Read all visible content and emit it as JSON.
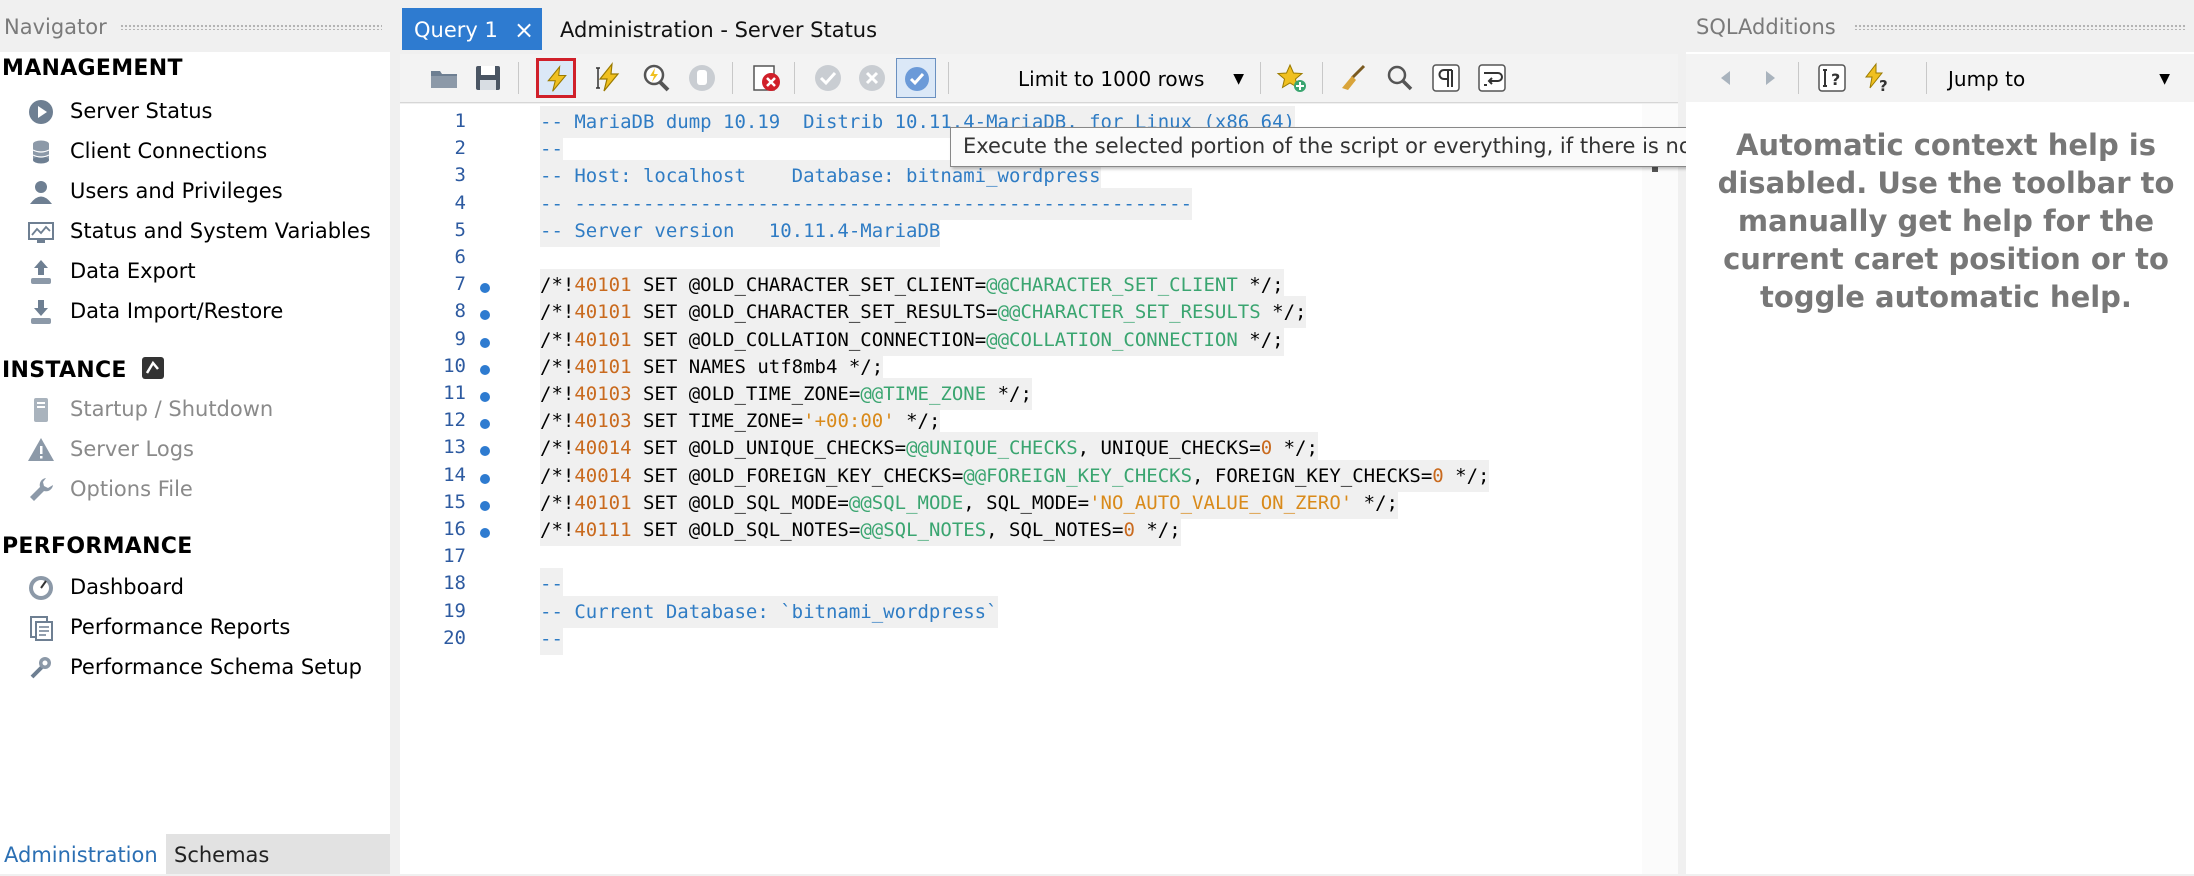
{
  "navigator": {
    "title": "Navigator",
    "management": {
      "heading": "MANAGEMENT",
      "items": [
        "Server Status",
        "Client Connections",
        "Users and Privileges",
        "Status and System Variables",
        "Data Export",
        "Data Import/Restore"
      ]
    },
    "instance": {
      "heading": "INSTANCE",
      "items": [
        "Startup / Shutdown",
        "Server Logs",
        "Options File"
      ]
    },
    "performance": {
      "heading": "PERFORMANCE",
      "items": [
        "Dashboard",
        "Performance Reports",
        "Performance Schema Setup"
      ]
    },
    "tabs": [
      "Administration",
      "Schemas"
    ]
  },
  "editor": {
    "tabs": [
      "Query 1",
      "Administration - Server Status"
    ],
    "close_glyph": "×",
    "limit_select": "Limit to 1000 rows",
    "tooltip": "Execute the selected portion of the script or everything, if there is no selection",
    "lines": [
      {
        "n": "1",
        "t": "-- MariaDB dump 10.19  Distrib 10.11.4-MariaDB, for Linux (x86_64)"
      },
      {
        "n": "2",
        "t": "--"
      },
      {
        "n": "3",
        "t": "-- Host: localhost    Database: bitnami_wordpress"
      },
      {
        "n": "4",
        "t": "-- ------------------------------------------------------"
      },
      {
        "n": "5",
        "t": "-- Server version\t10.11.4-MariaDB"
      },
      {
        "n": "6",
        "t": ""
      },
      {
        "n": "7",
        "t": "/*!40101 SET @OLD_CHARACTER_SET_CLIENT=@@CHARACTER_SET_CLIENT */;"
      },
      {
        "n": "8",
        "t": "/*!40101 SET @OLD_CHARACTER_SET_RESULTS=@@CHARACTER_SET_RESULTS */;"
      },
      {
        "n": "9",
        "t": "/*!40101 SET @OLD_COLLATION_CONNECTION=@@COLLATION_CONNECTION */;"
      },
      {
        "n": "10",
        "t": "/*!40101 SET NAMES utf8mb4 */;"
      },
      {
        "n": "11",
        "t": "/*!40103 SET @OLD_TIME_ZONE=@@TIME_ZONE */;"
      },
      {
        "n": "12",
        "t": "/*!40103 SET TIME_ZONE='+00:00' */;"
      },
      {
        "n": "13",
        "t": "/*!40014 SET @OLD_UNIQUE_CHECKS=@@UNIQUE_CHECKS, UNIQUE_CHECKS=0 */;"
      },
      {
        "n": "14",
        "t": "/*!40014 SET @OLD_FOREIGN_KEY_CHECKS=@@FOREIGN_KEY_CHECKS, FOREIGN_KEY_CHECKS=0 */;"
      },
      {
        "n": "15",
        "t": "/*!40101 SET @OLD_SQL_MODE=@@SQL_MODE, SQL_MODE='NO_AUTO_VALUE_ON_ZERO' */;"
      },
      {
        "n": "16",
        "t": "/*!40111 SET @OLD_SQL_NOTES=@@SQL_NOTES, SQL_NOTES=0 */;"
      },
      {
        "n": "17",
        "t": ""
      },
      {
        "n": "18",
        "t": "--"
      },
      {
        "n": "19",
        "t": "-- Current Database: `bitnami_wordpress`"
      },
      {
        "n": "20",
        "t": "--"
      }
    ]
  },
  "sql_additions": {
    "title": "SQLAdditions",
    "jump_to": "Jump to",
    "help_text": "Automatic context help is disabled. Use the toolbar to manually get help for the current caret position or to toggle automatic help."
  },
  "colors": {
    "accent": "#2e7bd0",
    "comment": "#2f7cc4",
    "number": "#c96a1e",
    "system_var": "#3aa570",
    "string": "#d98a1a",
    "highlight_border": "#d0202a"
  }
}
